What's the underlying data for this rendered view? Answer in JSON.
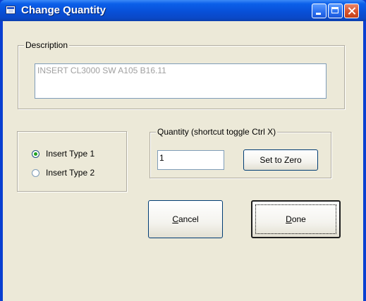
{
  "window": {
    "title": "Change Quantity"
  },
  "description": {
    "group_label": "Description",
    "value": "INSERT CL3000 SW A105 B16.11"
  },
  "insert_type": {
    "options": [
      {
        "label": "Insert Type 1",
        "checked": true
      },
      {
        "label": "Insert Type 2",
        "checked": false
      }
    ]
  },
  "quantity": {
    "group_label": "Quantity (shortcut toggle Ctrl X)",
    "value": "1",
    "set_to_zero_label": "Set to Zero"
  },
  "actions": {
    "cancel": {
      "accel": "C",
      "rest": "ancel"
    },
    "done": {
      "accel": "D",
      "rest": "one"
    }
  }
}
